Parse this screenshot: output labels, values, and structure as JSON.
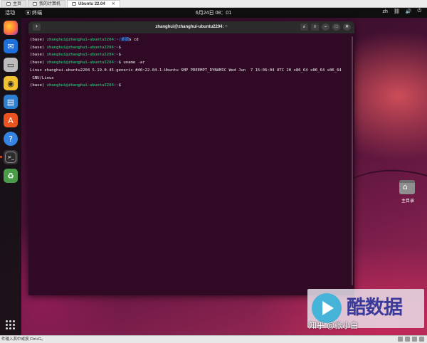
{
  "vm_tabs": [
    {
      "label": "主页",
      "active": false
    },
    {
      "label": "我的计算机",
      "active": false
    },
    {
      "label": "Ubuntu 22.04",
      "active": true
    }
  ],
  "topbar": {
    "activities": "活动",
    "app_menu": "终端",
    "clock": "6月24日  08：01",
    "input_method": "zh"
  },
  "dock": {
    "apps": [
      "firefox-icon",
      "thunderbird-icon",
      "files-icon",
      "rhythmbox-icon",
      "writer-icon",
      "software-icon",
      "help-icon",
      "terminal-icon",
      "trash-icon"
    ]
  },
  "terminal": {
    "title": "zhanghui@zhanghui-ubuntu2204: ~",
    "lines": [
      {
        "env": "(base) ",
        "user": "zhanghui@zhanghui-ubuntu2204",
        "path": ":~/桌面",
        "cmd": "$ cd"
      },
      {
        "env": "(base) ",
        "user": "zhanghui@zhanghui-ubuntu2204",
        "path": ":~",
        "cmd": "$"
      },
      {
        "env": "(base) ",
        "user": "zhanghui@zhanghui-ubuntu2204",
        "path": ":~",
        "cmd": "$"
      },
      {
        "env": "(base) ",
        "user": "zhanghui@zhanghui-ubuntu2204",
        "path": ":~",
        "cmd": "$ uname -ar"
      },
      {
        "output": "Linux zhanghui-ubuntu2204 5.19.0-45-generic #46~22.04.1-Ubuntu SMP PREEMPT_DYNAMIC Wed Jun  7 15:06:04 UTC 20 x86_64 x86_64 x86_64"
      },
      {
        "output": " GNU/Linux"
      },
      {
        "env": "(base) ",
        "user": "zhanghui@zhanghui-ubuntu2204",
        "path": ":~",
        "cmd": "$"
      }
    ]
  },
  "desktop": {
    "home_label": "主目录"
  },
  "status_bar": {
    "text": "件输入其中或按 Ctrl+G。"
  },
  "watermark": {
    "big": "酷数据",
    "small": "知乎 @张小白"
  },
  "colors": {
    "accent": "#e95420",
    "prompt_user": "#26a269",
    "prompt_path": "#3584e4",
    "terminal_bg": "#300a24"
  }
}
